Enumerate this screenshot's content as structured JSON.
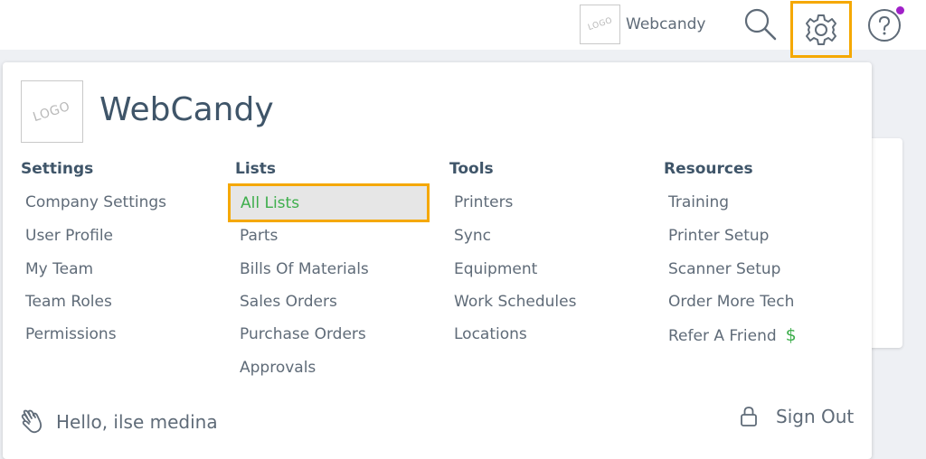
{
  "topbar": {
    "logo_text": "LOGO",
    "company_name": "Webcandy",
    "icons": [
      "search-icon",
      "gear-icon",
      "help-icon"
    ],
    "notification_dot_color": "#a020c8"
  },
  "panel": {
    "logo_text": "LOGO",
    "company_name": "WebCandy",
    "columns": [
      {
        "heading": "Settings",
        "items": [
          "Company Settings",
          "User Profile",
          "My Team",
          "Team Roles",
          "Permissions"
        ]
      },
      {
        "heading": "Lists",
        "items": [
          "All Lists",
          "Parts",
          "Bills Of Materials",
          "Sales Orders",
          "Purchase Orders",
          "Approvals"
        ],
        "active_item": "All Lists"
      },
      {
        "heading": "Tools",
        "items": [
          "Printers",
          "Sync",
          "Equipment",
          "Work Schedules",
          "Locations"
        ]
      },
      {
        "heading": "Resources",
        "items": [
          "Training",
          "Printer Setup",
          "Scanner Setup",
          "Order More Tech",
          "Refer A Friend"
        ],
        "refer_badge": "$"
      }
    ],
    "greeting": "Hello, ilse medina",
    "sign_out_label": "Sign Out"
  },
  "colors": {
    "highlight_border": "#f5a800",
    "active_text": "#3eae4c",
    "heading_text": "#3f5569",
    "body_text": "#5f6b78"
  }
}
